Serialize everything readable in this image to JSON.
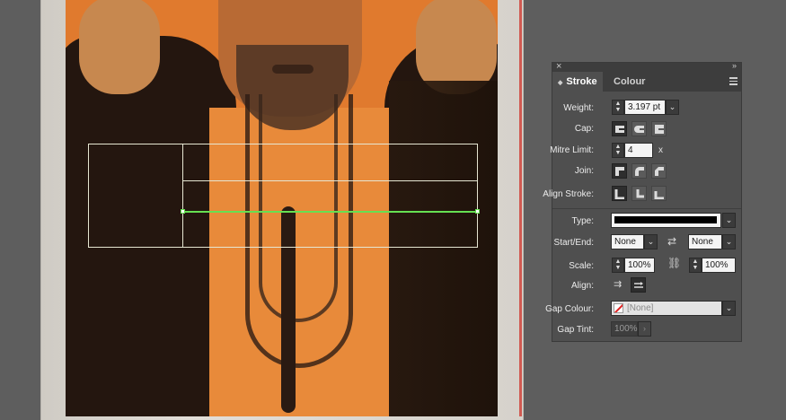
{
  "panel": {
    "tabs": [
      {
        "label": "Stroke",
        "active": true
      },
      {
        "label": "Colour",
        "active": false
      }
    ],
    "weight": {
      "label": "Weight:",
      "value": "3.197 pt"
    },
    "cap": {
      "label": "Cap:",
      "selected": "butt"
    },
    "mitre_limit": {
      "label": "Mitre Limit:",
      "value": "4",
      "suffix": "x"
    },
    "join": {
      "label": "Join:",
      "selected": "miter"
    },
    "align_stroke": {
      "label": "Align Stroke:",
      "selected": "center"
    },
    "type": {
      "label": "Type:"
    },
    "start_end": {
      "label": "Start/End:",
      "start": "None",
      "end": "None"
    },
    "scale": {
      "label": "Scale:",
      "start": "100%",
      "end": "100%"
    },
    "align": {
      "label": "Align:",
      "selected": "extend-tip"
    },
    "gap_colour": {
      "label": "Gap Colour:",
      "value": "[None]"
    },
    "gap_tint": {
      "label": "Gap Tint:",
      "value": "100%"
    }
  },
  "colors": {
    "panel_bg": "#4f4f4f",
    "selection": "#66e052",
    "artwork_orange": "#e07a2e"
  }
}
